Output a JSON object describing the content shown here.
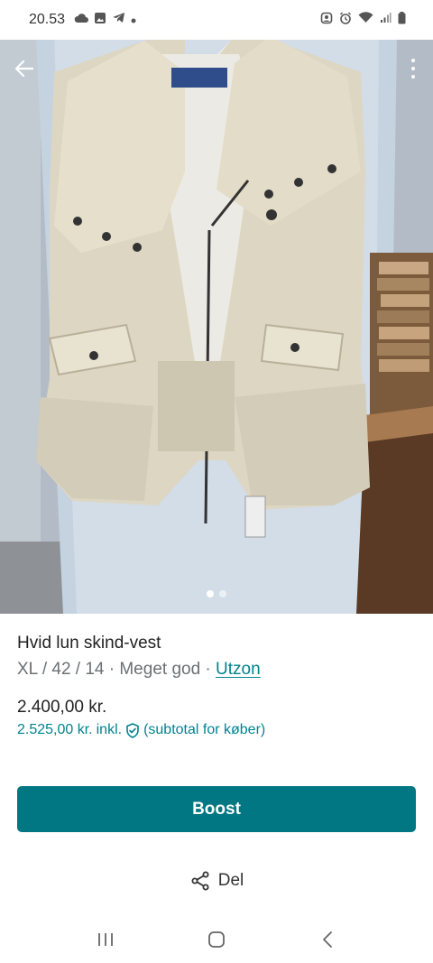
{
  "status_bar": {
    "time": "20.53"
  },
  "gallery": {
    "image_count": 2,
    "active_index": 0
  },
  "item": {
    "title": "Hvid lun skind-vest",
    "details": "XL / 42 / 14 · Meget god · ",
    "brand": "Utzon",
    "price": "2.400,00 kr.",
    "price_incl_amount": "2.525,00 kr.",
    "price_incl_label": "inkl.",
    "price_incl_note": "(subtotal for køber)"
  },
  "actions": {
    "boost_label": "Boost",
    "share_label": "Del"
  },
  "colors": {
    "accent": "#007782",
    "link": "#00838f"
  }
}
